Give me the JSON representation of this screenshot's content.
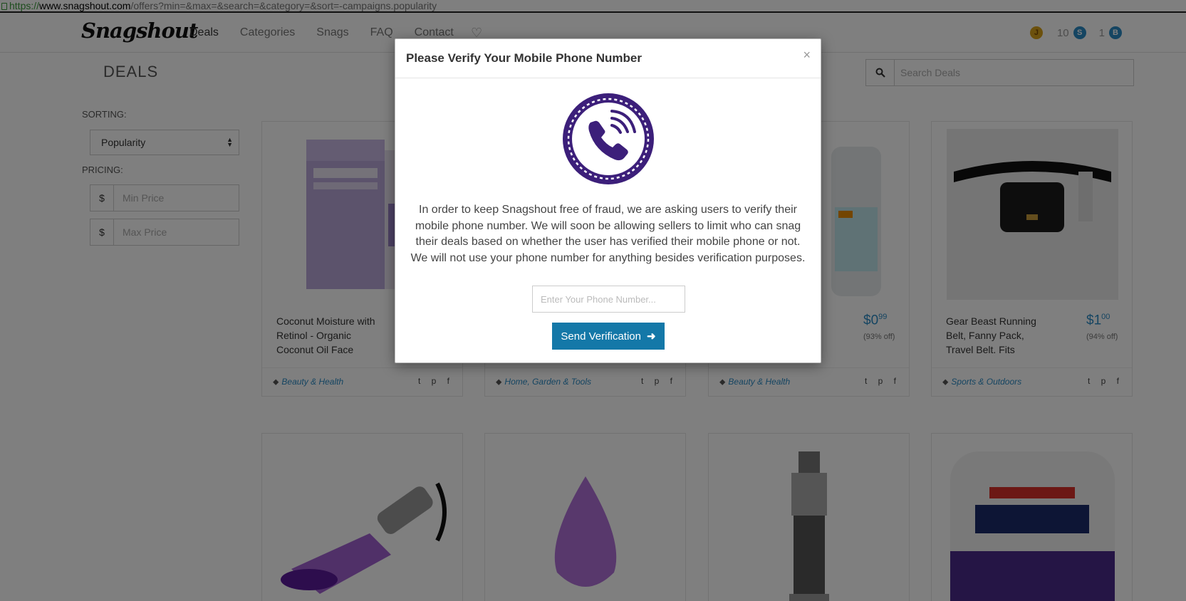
{
  "browser": {
    "url_scheme": "https://",
    "url_host": "www.snagshout.com",
    "url_path": "/offers?min=&max=&search=&category=&sort=-campaigns.popularity"
  },
  "nav": {
    "logo": "Snagshout",
    "links": [
      "Deals",
      "Categories",
      "Snags",
      "FAQ",
      "Contact"
    ],
    "heart_icon": "♡",
    "user_initial": "J",
    "balance_1": "10",
    "balance_1_icon": "S",
    "balance_2": "1",
    "balance_2_icon": "B"
  },
  "page": {
    "title": "DEALS",
    "search_placeholder": "Search Deals"
  },
  "sidebar": {
    "sorting_label": "SORTING:",
    "sort_value": "Popularity",
    "pricing_label": "PRICING:",
    "currency": "$",
    "min_placeholder": "Min Price",
    "max_placeholder": "Max Price"
  },
  "cards": [
    {
      "name": "Coconut Moisture with Retinol - Organic Coconut Oil Face",
      "price_main": "",
      "price_cents": "",
      "off": "",
      "category": "Beauty & Health"
    },
    {
      "name": "",
      "price_main": "",
      "price_cents": "",
      "off": "",
      "category": "Home, Garden & Tools"
    },
    {
      "name": "",
      "price_main": "$0",
      "price_cents": "99",
      "off": "(93% off)",
      "category": "Beauty & Health"
    },
    {
      "name": "Gear Beast Running Belt, Fanny Pack, Travel Belt. Fits iPhones and",
      "price_main": "$1",
      "price_cents": "00",
      "off": "(94% off)",
      "category": "Sports & Outdoors"
    }
  ],
  "social_icons": "t p f",
  "modal": {
    "title": "Please Verify Your Mobile Phone Number",
    "close": "×",
    "body": "In order to keep Snagshout free of fraud, we are asking users to verify their mobile phone number. We will soon be allowing sellers to limit who can snag their deals based on whether the user has verified their mobile phone or not. We will not use your phone number for anything besides verification purposes.",
    "phone_placeholder": "Enter Your Phone Number...",
    "send_label": "Send Verification",
    "accent_color": "#3c1f7a",
    "button_color": "#1478a8"
  }
}
